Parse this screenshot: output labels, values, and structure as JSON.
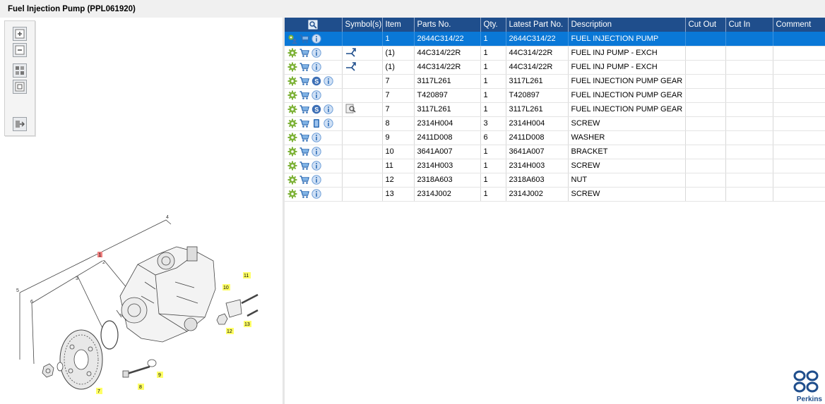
{
  "window": {
    "title": "Fuel Injection Pump (PPL061920)"
  },
  "toolbox": {
    "tools": [
      {
        "name": "zoom-in-icon"
      },
      {
        "name": "zoom-out-icon"
      },
      {
        "name": "fit-all-icon"
      },
      {
        "name": "fit-page-icon"
      },
      {
        "name": "export-icon"
      }
    ]
  },
  "table": {
    "headers": [
      "",
      "Symbol(s)",
      "Item",
      "Parts No.",
      "Qty.",
      "Latest Part No.",
      "Description",
      "Cut Out",
      "Cut In",
      "Comment"
    ],
    "rows": [
      {
        "icons": [
          "gear-person",
          "cart",
          "info"
        ],
        "symbol": "",
        "item": "1",
        "part": "2644C314/22",
        "qty": "1",
        "latest": "2644C314/22",
        "desc": "FUEL INJECTION PUMP",
        "cutout": "",
        "cutin": "",
        "comment": "",
        "selected": true
      },
      {
        "icons": [
          "gear",
          "cart",
          "info"
        ],
        "symbol": "exchange",
        "item": "(1)",
        "part": "44C314/22R",
        "qty": "1",
        "latest": "44C314/22R",
        "desc": "FUEL INJ PUMP - EXCH",
        "cutout": "",
        "cutin": "",
        "comment": ""
      },
      {
        "icons": [
          "gear",
          "cart",
          "info"
        ],
        "symbol": "exchange",
        "item": "(1)",
        "part": "44C314/22R",
        "qty": "1",
        "latest": "44C314/22R",
        "desc": "FUEL INJ PUMP - EXCH",
        "cutout": "",
        "cutin": "",
        "comment": ""
      },
      {
        "icons": [
          "gear",
          "cart",
          "s",
          "info"
        ],
        "symbol": "",
        "item": "7",
        "part": "3117L261",
        "qty": "1",
        "latest": "3117L261",
        "desc": "FUEL INJECTION PUMP GEAR",
        "cutout": "",
        "cutin": "",
        "comment": ""
      },
      {
        "icons": [
          "gear",
          "cart",
          "info"
        ],
        "symbol": "",
        "item": "7",
        "part": "T420897",
        "qty": "1",
        "latest": "T420897",
        "desc": "FUEL INJECTION PUMP GEAR",
        "cutout": "",
        "cutin": "",
        "comment": ""
      },
      {
        "icons": [
          "gear",
          "cart",
          "s",
          "info"
        ],
        "symbol": "view",
        "item": "7",
        "part": "3117L261",
        "qty": "1",
        "latest": "3117L261",
        "desc": "FUEL INJECTION PUMP GEAR",
        "cutout": "",
        "cutin": "",
        "comment": ""
      },
      {
        "icons": [
          "gear",
          "cart",
          "book",
          "info"
        ],
        "symbol": "",
        "item": "8",
        "part": "2314H004",
        "qty": "3",
        "latest": "2314H004",
        "desc": "SCREW",
        "cutout": "",
        "cutin": "",
        "comment": ""
      },
      {
        "icons": [
          "gear",
          "cart",
          "info"
        ],
        "symbol": "",
        "item": "9",
        "part": "2411D008",
        "qty": "6",
        "latest": "2411D008",
        "desc": "WASHER",
        "cutout": "",
        "cutin": "",
        "comment": ""
      },
      {
        "icons": [
          "gear",
          "cart",
          "info"
        ],
        "symbol": "",
        "item": "10",
        "part": "3641A007",
        "qty": "1",
        "latest": "3641A007",
        "desc": "BRACKET",
        "cutout": "",
        "cutin": "",
        "comment": ""
      },
      {
        "icons": [
          "gear",
          "cart",
          "info"
        ],
        "symbol": "",
        "item": "11",
        "part": "2314H003",
        "qty": "1",
        "latest": "2314H003",
        "desc": "SCREW",
        "cutout": "",
        "cutin": "",
        "comment": ""
      },
      {
        "icons": [
          "gear",
          "cart",
          "info"
        ],
        "symbol": "",
        "item": "12",
        "part": "2318A603",
        "qty": "1",
        "latest": "2318A603",
        "desc": "NUT",
        "cutout": "",
        "cutin": "",
        "comment": ""
      },
      {
        "icons": [
          "gear",
          "cart",
          "info"
        ],
        "symbol": "",
        "item": "13",
        "part": "2314J002",
        "qty": "1",
        "latest": "2314J002",
        "desc": "SCREW",
        "cutout": "",
        "cutin": "",
        "comment": ""
      }
    ]
  },
  "diagram": {
    "callouts_yellow": [
      "7",
      "8",
      "9",
      "10",
      "11",
      "12",
      "13"
    ],
    "callout_red": "1",
    "leaders": [
      "2",
      "3",
      "4",
      "5",
      "6"
    ]
  },
  "brand": {
    "name": "Perkins"
  },
  "colors": {
    "header": "#1f4e8c",
    "selected": "#0a78d7",
    "callout": "#ffff66"
  }
}
